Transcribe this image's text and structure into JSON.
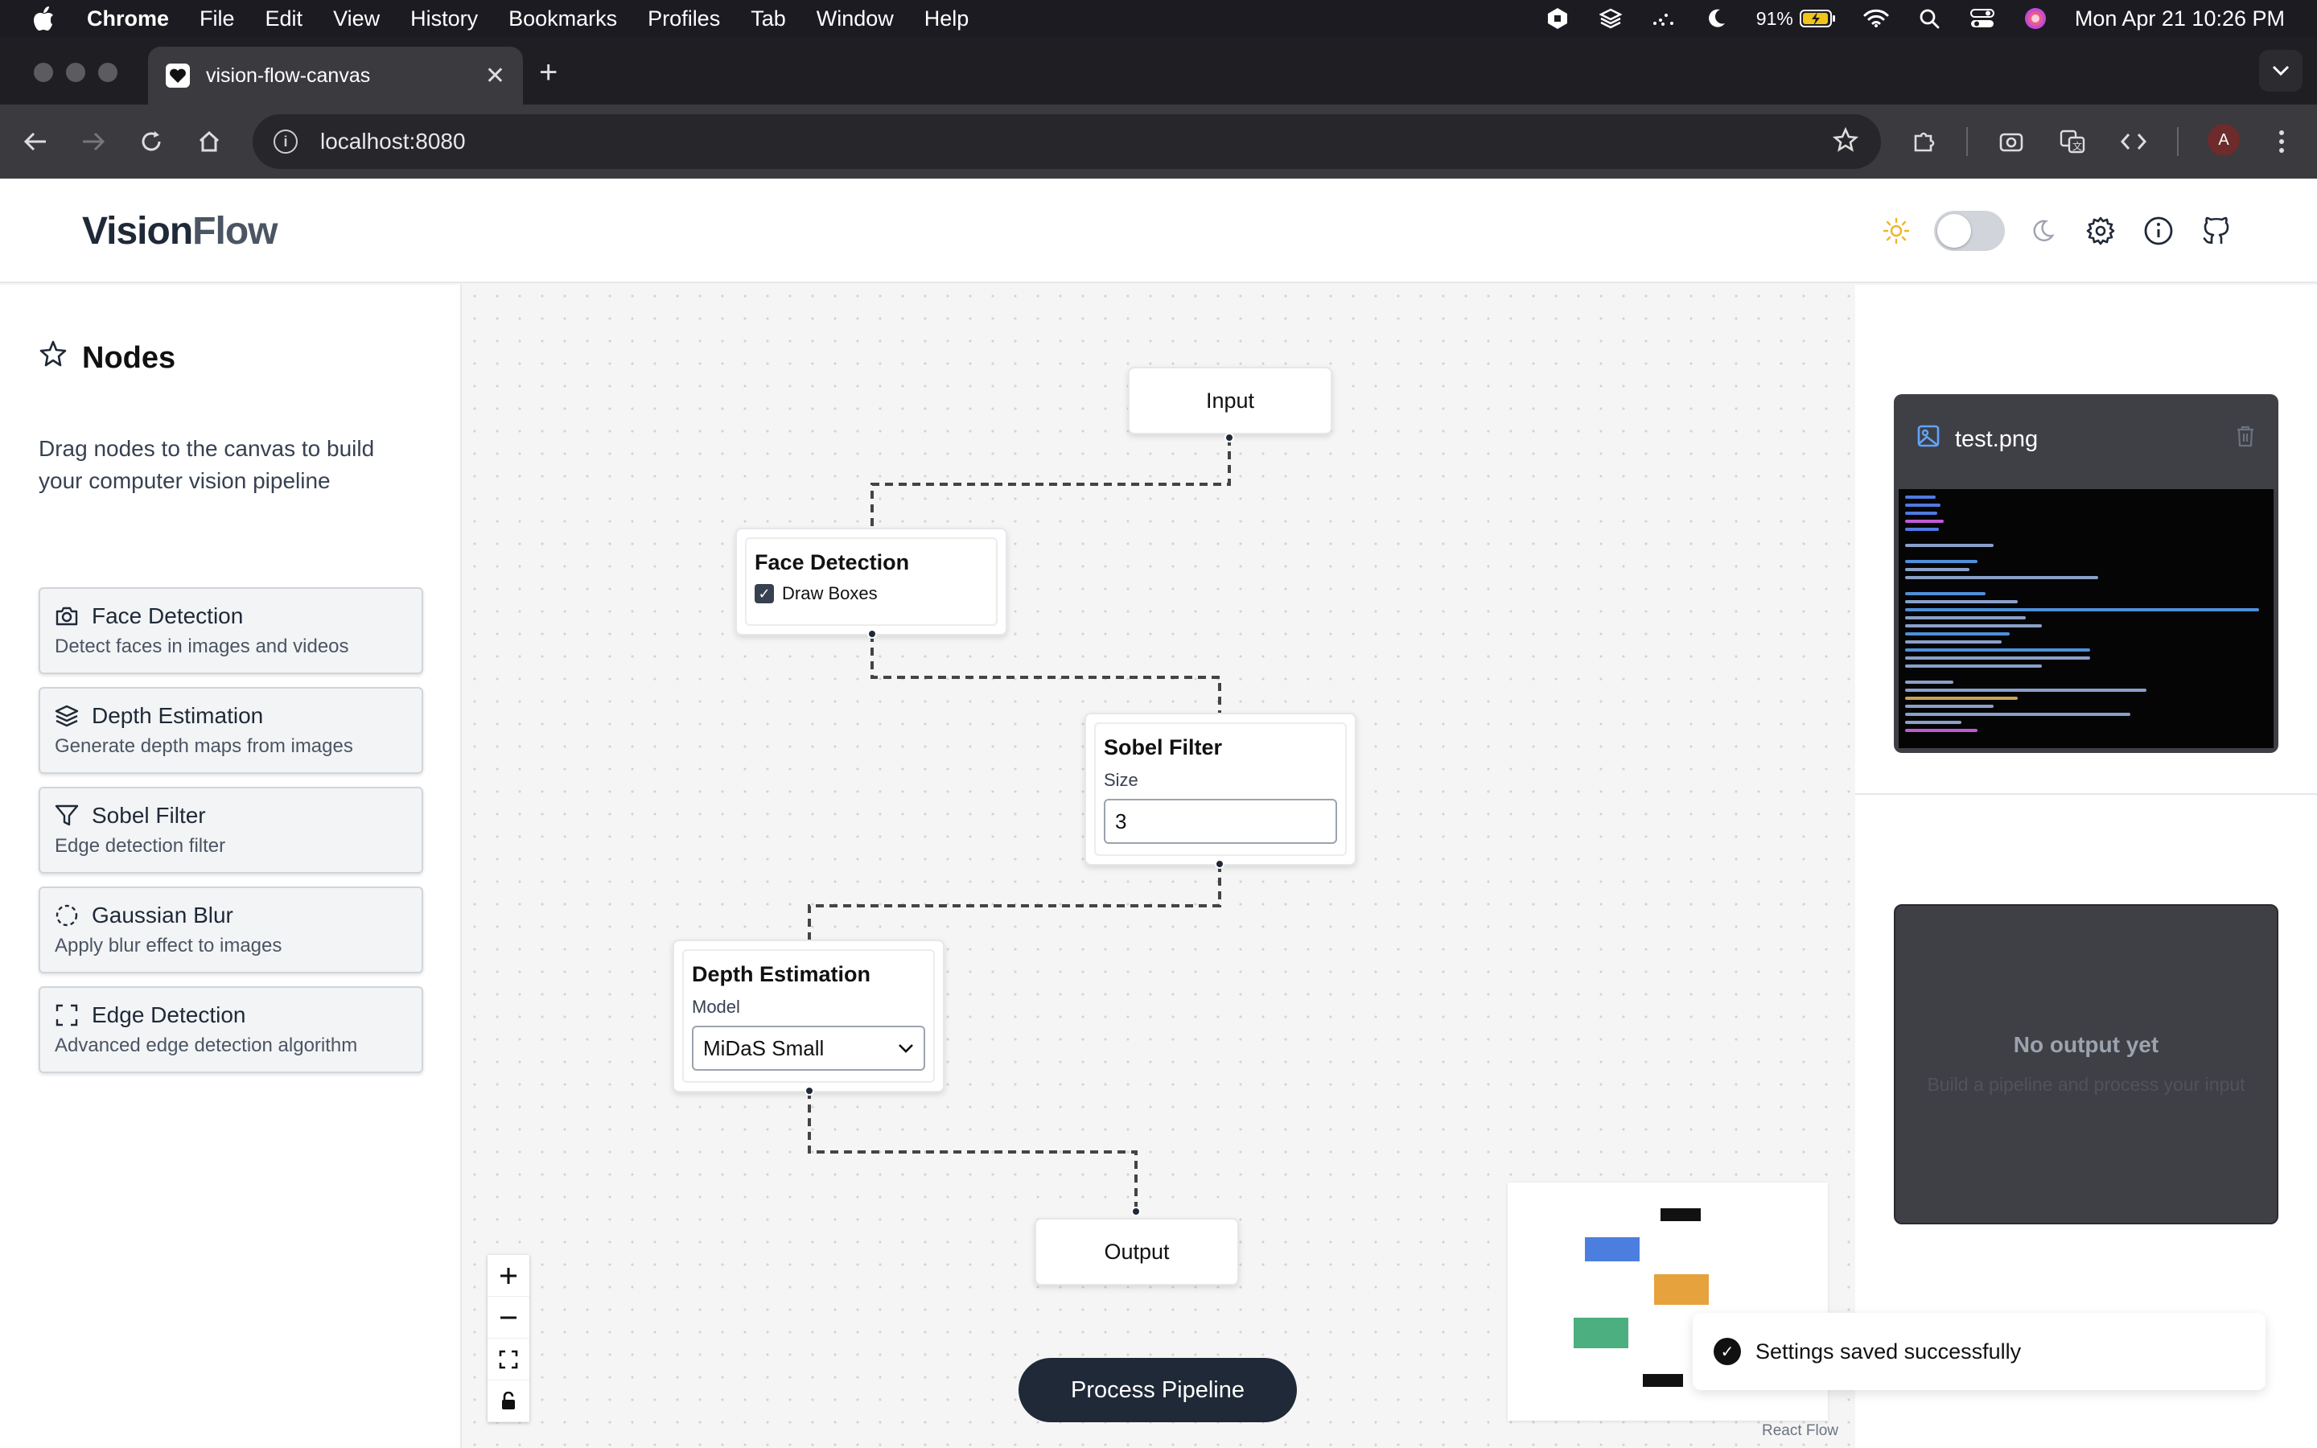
{
  "menubar": {
    "app": "Chrome",
    "items": [
      "File",
      "Edit",
      "View",
      "History",
      "Bookmarks",
      "Profiles",
      "Tab",
      "Window",
      "Help"
    ],
    "battery": "91%",
    "datetime": "Mon Apr 21  10:26 PM"
  },
  "browser": {
    "tab_title": "vision-flow-canvas",
    "url": "localhost:8080",
    "avatar_initial": "A"
  },
  "header": {
    "logo_part1": "Vision",
    "logo_part2": "Flow"
  },
  "sidebar": {
    "title": "Nodes",
    "description": "Drag nodes to the canvas to build your computer vision pipeline",
    "items": [
      {
        "name": "Face Detection",
        "desc": "Detect faces in images and videos",
        "icon": "camera-icon"
      },
      {
        "name": "Depth Estimation",
        "desc": "Generate depth maps from images",
        "icon": "layers-icon"
      },
      {
        "name": "Sobel Filter",
        "desc": "Edge detection filter",
        "icon": "filter-icon"
      },
      {
        "name": "Gaussian Blur",
        "desc": "Apply blur effect to images",
        "icon": "dashed-circle-icon"
      },
      {
        "name": "Edge Detection",
        "desc": "Advanced edge detection algorithm",
        "icon": "scan-icon"
      }
    ]
  },
  "canvas": {
    "input_node": "Input",
    "output_node": "Output",
    "face_node": {
      "title": "Face Detection",
      "checkbox_label": "Draw Boxes",
      "checked": true
    },
    "sobel_node": {
      "title": "Sobel Filter",
      "field_label": "Size",
      "value": "3"
    },
    "depth_node": {
      "title": "Depth Estimation",
      "field_label": "Model",
      "value": "MiDaS Small"
    },
    "process_button": "Process Pipeline",
    "attribution": "React Flow"
  },
  "right_panel": {
    "input_file": "test.png",
    "output_title": "No output yet",
    "output_subtitle": "Build a pipeline and process your input"
  },
  "toast": {
    "message": "Settings saved successfully"
  },
  "colors": {
    "minimap_blue": "#4c7ee0",
    "minimap_orange": "#e6a23c",
    "minimap_green": "#4caf80",
    "primary_dark": "#1f2937"
  }
}
